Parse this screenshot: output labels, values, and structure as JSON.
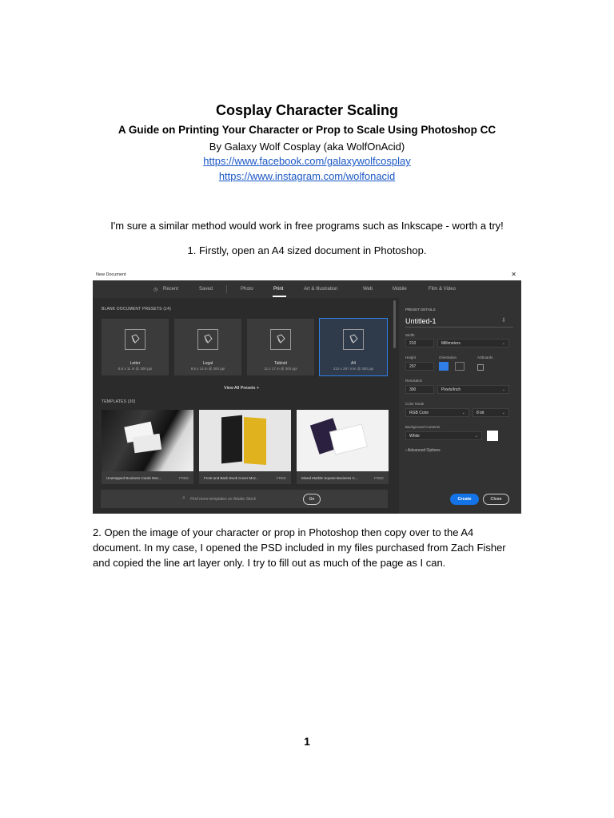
{
  "document": {
    "title": "Cosplay Character Scaling",
    "subtitle": "A Guide on Printing Your Character or Prop to Scale Using Photoshop CC",
    "author": "By Galaxy Wolf Cosplay (aka WolfOnAcid)",
    "links": [
      "https://www.facebook.com/galaxywolfcosplay",
      "https://www.instagram.com/wolfonacid"
    ],
    "intro": "I'm sure a similar method would work in free programs such as Inkscape - worth a try!",
    "step1": "1. Firstly, open an A4 sized document in Photoshop.",
    "step2": "2. Open the image of your character or prop in Photoshop then copy over to the A4 document. In my case, I opened the PSD included in my files purchased from Zach Fisher and copied the line art layer only. I try to fill out as much of the page as I can.",
    "page_number": "1"
  },
  "screenshot": {
    "window_title": "New Document",
    "close_glyph": "✕",
    "tabs": [
      "Recent",
      "Saved",
      "Photo",
      "Print",
      "Art & Illustration",
      "Web",
      "Mobile",
      "Film & Video"
    ],
    "active_tab": "Print",
    "blank_presets_label": "BLANK DOCUMENT PRESETS",
    "blank_presets_count": "(14)",
    "presets": [
      {
        "name": "Letter",
        "dims": "8.5 x 11 in @ 300 ppi"
      },
      {
        "name": "Legal",
        "dims": "8.5 x 14 in @ 300 ppi"
      },
      {
        "name": "Tabloid",
        "dims": "11 x 17 in @ 300 ppi"
      },
      {
        "name": "A4",
        "dims": "210 x 297 mm @ 300 ppi"
      }
    ],
    "selected_preset": "A4",
    "view_all": "View All Presets",
    "view_all_plus": "+",
    "templates_label": "TEMPLATES",
    "templates_count": "(30)",
    "templates": [
      {
        "name": "Unwrapped Business Cards Moc...",
        "badge": "FREE"
      },
      {
        "name": "Front and Back Book Cover Moc...",
        "badge": "FREE"
      },
      {
        "name": "Mixed Marble Square Business C...",
        "badge": "FREE"
      }
    ],
    "search_placeholder": "Find more templates on Adobe Stock",
    "go_button": "Go",
    "preset_details_label": "PRESET DETAILS",
    "doc_name": "Untitled-1",
    "width_label": "Width",
    "width_value": "210",
    "width_unit": "Millimeters",
    "height_label": "Height",
    "height_value": "297",
    "orientation_label": "Orientation",
    "artboards_label": "Artboards",
    "resolution_label": "Resolution",
    "resolution_value": "300",
    "resolution_unit": "Pixels/Inch",
    "color_mode_label": "Color Mode",
    "color_mode_value": "RGB Color",
    "bit_depth": "8 bit",
    "background_label": "Background Contents",
    "background_value": "White",
    "advanced_options": "Advanced Options",
    "create_button": "Create",
    "close_button": "Close",
    "colors": {
      "accent": "#1473e6",
      "panel": "#2b2b2b",
      "link": "#1a56c4"
    }
  }
}
